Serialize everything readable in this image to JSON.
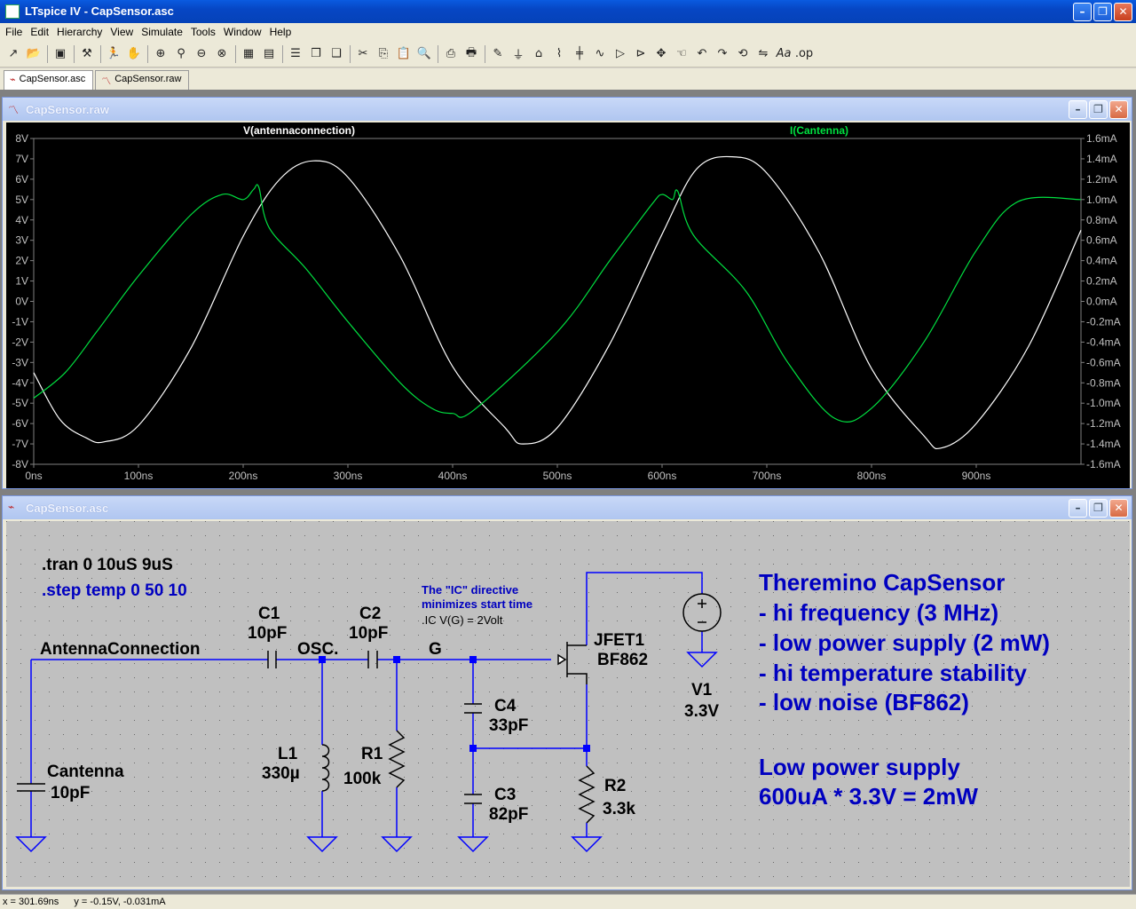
{
  "window": {
    "title": "LTspice IV - CapSensor.asc"
  },
  "menu": [
    "File",
    "Edit",
    "Hierarchy",
    "View",
    "Simulate",
    "Tools",
    "Window",
    "Help"
  ],
  "tabs": [
    {
      "label": "CapSensor.asc",
      "active": true
    },
    {
      "label": "CapSensor.raw",
      "active": false
    }
  ],
  "plot_window": {
    "title": "CapSensor.raw"
  },
  "schematic_window": {
    "title": "CapSensor.asc"
  },
  "chart_data": {
    "type": "line",
    "series": [
      {
        "name": "V(antennaconnection)",
        "color": "#ffffff",
        "axis": "left",
        "x": [
          0,
          25,
          50,
          67,
          100,
          150,
          200,
          235,
          267,
          300,
          350,
          400,
          450,
          467,
          500,
          550,
          600,
          633,
          667,
          700,
          750,
          800,
          850,
          867,
          900,
          950,
          1000
        ],
        "y": [
          -3.5,
          -5.8,
          -6.7,
          -6.9,
          -6.1,
          -2.3,
          3.2,
          6.0,
          6.9,
          6.1,
          2.2,
          -3.2,
          -6.2,
          -7.0,
          -6.2,
          -2.1,
          3.3,
          6.5,
          7.1,
          6.3,
          2.4,
          -3.3,
          -6.6,
          -7.2,
          -6.0,
          -2.2,
          3.5
        ]
      },
      {
        "name": "I(Cantenna)",
        "color": "#00e040",
        "axis": "right",
        "x": [
          0,
          30,
          60,
          100,
          150,
          180,
          200,
          210,
          215,
          225,
          260,
          300,
          350,
          380,
          400,
          420,
          500,
          550,
          590,
          600,
          610,
          615,
          630,
          680,
          720,
          765,
          800,
          850,
          900,
          940,
          1000
        ],
        "y": [
          -0.95,
          -0.7,
          -0.3,
          0.25,
          0.85,
          1.05,
          1.0,
          1.1,
          1.12,
          0.72,
          0.32,
          -0.2,
          -0.8,
          -1.05,
          -1.1,
          -1.07,
          -0.3,
          0.4,
          0.95,
          1.05,
          1.0,
          1.08,
          0.65,
          0.1,
          -0.6,
          -1.15,
          -1.05,
          -0.4,
          0.5,
          0.98,
          1.0
        ]
      }
    ],
    "xlabel": "",
    "x_ticks": [
      "0ns",
      "100ns",
      "200ns",
      "300ns",
      "400ns",
      "500ns",
      "600ns",
      "700ns",
      "800ns",
      "900ns"
    ],
    "xlim": [
      0,
      1000
    ],
    "y_left_ticks": [
      "8V",
      "7V",
      "6V",
      "5V",
      "4V",
      "3V",
      "2V",
      "1V",
      "0V",
      "-1V",
      "-2V",
      "-3V",
      "-4V",
      "-5V",
      "-6V",
      "-7V",
      "-8V"
    ],
    "ylim_left": [
      -8,
      8
    ],
    "y_right_ticks": [
      "1.6mA",
      "1.4mA",
      "1.2mA",
      "1.0mA",
      "0.8mA",
      "0.6mA",
      "0.4mA",
      "0.2mA",
      "0.0mA",
      "-0.2mA",
      "-0.4mA",
      "-0.6mA",
      "-0.8mA",
      "-1.0mA",
      "-1.2mA",
      "-1.4mA",
      "-1.6mA"
    ],
    "ylim_right": [
      -1.6,
      1.6
    ],
    "grid": false
  },
  "schematic": {
    "directives": [
      ".tran 0 10uS 9uS",
      ".step temp 0 50 10"
    ],
    "comment_lines": [
      "The \"IC\" directive",
      "minimizes start time"
    ],
    "ic_directive": ".IC V(G) = 2Volt",
    "net_labels": [
      "AntennaConnection",
      "OSC.",
      "G"
    ],
    "components": {
      "C1": [
        "C1",
        "10pF"
      ],
      "C2": [
        "C2",
        "10pF"
      ],
      "C3": [
        "C3",
        "82pF"
      ],
      "C4": [
        "C4",
        "33pF"
      ],
      "L1": [
        "L1",
        "330µ"
      ],
      "R1": [
        "R1",
        "100k"
      ],
      "R2": [
        "R2",
        "3.3k"
      ],
      "Cantenna": [
        "Cantenna",
        "10pF"
      ],
      "JFET1": [
        "JFET1",
        "BF862"
      ],
      "V1": [
        "V1",
        "3.3V"
      ]
    },
    "notes": [
      "Theremino CapSensor",
      "- hi frequency (3 MHz)",
      "- low power supply (2 mW)",
      "- hi temperature stability",
      "- low noise (BF862)",
      "Low power supply",
      "600uA * 3.3V = 2mW"
    ],
    "wire_color": "#0000ff",
    "text_color_blue": "#0000c0"
  },
  "status": {
    "x": "x = 301.69ns",
    "y": "y = -0.15V, -0.031mA"
  }
}
